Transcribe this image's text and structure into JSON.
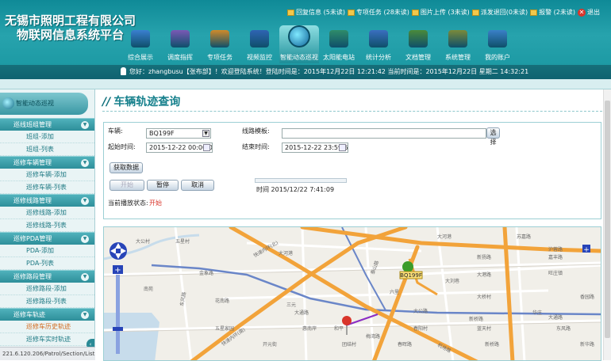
{
  "brand": {
    "line1": "无锡市照明工程有限公司",
    "line2": "物联网信息系统平台"
  },
  "top_links": [
    {
      "label": "回复信息 (5未读)"
    },
    {
      "label": "专项任务 (28未读)"
    },
    {
      "label": "图片上传 (3未读)"
    },
    {
      "label": "派发退回(0未读)"
    },
    {
      "label": "报警 (2未读)"
    },
    {
      "label": "退出"
    }
  ],
  "nav_tabs": [
    {
      "label": "综合展示",
      "color": "#3a7fd0"
    },
    {
      "label": "调度指挥",
      "color": "#7a59b5"
    },
    {
      "label": "专项任务",
      "color": "#d08a2a"
    },
    {
      "label": "视频监控",
      "color": "#2f64b3"
    },
    {
      "label": "智能动态巡视",
      "color": "#1a7fae",
      "active": true
    },
    {
      "label": "太阳能电站",
      "color": "#2f8c6a"
    },
    {
      "label": "统计分析",
      "color": "#3a6fc0"
    },
    {
      "label": "文档管理",
      "color": "#4a8a3a"
    },
    {
      "label": "系统管理",
      "color": "#7a8a3a"
    },
    {
      "label": "我的账户",
      "color": "#3a80c8"
    }
  ],
  "info_bar": {
    "text": "您好：zhangbusu【张布部】！欢迎登陆系统！登陆时间是：2015年12月22日 12:21:42     当前时间是：2015年12月22日 星期二  14:32:21"
  },
  "sidebar": {
    "header": "智能动态巡视",
    "sections": [
      {
        "title": "巡线班组管理",
        "items": [
          "班组-添加",
          "班组-列表"
        ]
      },
      {
        "title": "巡修车辆管理",
        "items": [
          "巡修车辆-添加",
          "巡修车辆-列表"
        ]
      },
      {
        "title": "巡修线路管理",
        "items": [
          "巡修线路-添加",
          "巡修线路-列表"
        ]
      },
      {
        "title": "巡修PDA管理",
        "items": [
          "PDA-添加",
          "PDA-列表"
        ]
      },
      {
        "title": "巡修路段管理",
        "items": [
          "巡修路段-添加",
          "巡修路段-列表"
        ]
      },
      {
        "title": "巡修车轨迹",
        "items": [
          "巡修车历史轨迹",
          "巡修车实时轨迹"
        ]
      }
    ],
    "current_item": "巡修车历史轨迹"
  },
  "page": {
    "title": "车辆轨迹查询"
  },
  "form": {
    "vehicle_label": "车辆:",
    "vehicle_value": "BQ199F",
    "route_template_label": "线路模板:",
    "route_template_value": "",
    "select_button": "选择",
    "start_label": "起始时间:",
    "start_value": "2015-12-22 00:00:00",
    "end_label": "结束时间:",
    "end_value": "2015-12-22 23:59:59",
    "fetch_button": "获取数据",
    "play_button": "开始",
    "pause_button": "暂停",
    "cancel_button": "取消",
    "time_label": "时间",
    "time_value": "2015/12/22 7:41:09",
    "status_label": "当前播放状态:",
    "status_value": "开始",
    "status_color": "#d9352b"
  },
  "map": {
    "vehicle_label": "BQ199F",
    "road_labels": [
      "快速内环(南)",
      "快速内环(北)",
      "机场路",
      "沪蓉路",
      "泰山路",
      "大港路",
      "大通路",
      "梅湾路",
      "大公路",
      "惠南岸",
      "新桥路",
      "大通路",
      "东风路",
      "大刘巷"
    ],
    "place_labels": [
      "大河港",
      "南苑",
      "五星家园",
      "大河港",
      "苏嘉路",
      "嘉丰路",
      "旺庄镇",
      "新扬路",
      "花南路",
      "三元",
      "和平",
      "六里",
      "大桥村",
      "大公村",
      "五星村",
      "华庄",
      "蓝天村",
      "团结村",
      "春阳村",
      "开元街",
      "新桥路",
      "东风路",
      "金象路",
      "春晖路",
      "新华路",
      "香园路"
    ]
  },
  "status_bar": {
    "url": "221.6.120.206/Patrol/Section/List.aspx"
  }
}
